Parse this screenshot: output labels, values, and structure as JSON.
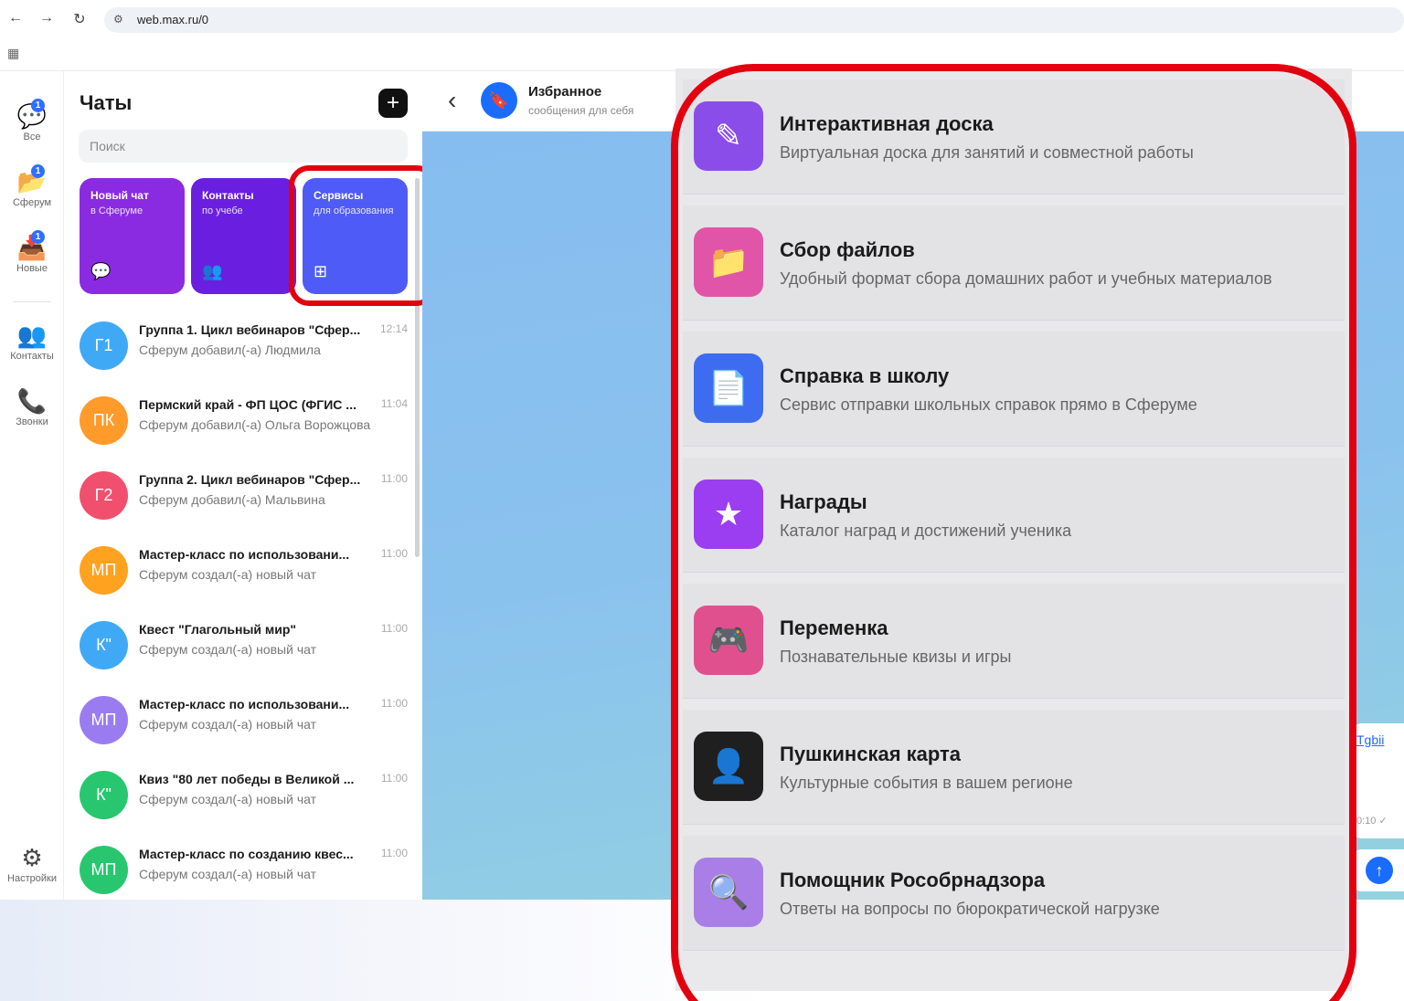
{
  "browser": {
    "url": "web.max.ru/0"
  },
  "rail": {
    "items": [
      {
        "label": "Все",
        "badge": "1"
      },
      {
        "label": "Сферум",
        "badge": "1"
      },
      {
        "label": "Новые",
        "badge": "1"
      },
      {
        "label": "Контакты"
      },
      {
        "label": "Звонки"
      }
    ],
    "settings_label": "Настройки"
  },
  "sidebar": {
    "title": "Чаты",
    "search_placeholder": "Поиск",
    "cards": [
      {
        "title": "Новый чат",
        "subtitle": "в Сферуме",
        "color": "#8a2be2"
      },
      {
        "title": "Контакты",
        "subtitle": "по учебе",
        "color": "#6a1fe0"
      },
      {
        "title": "Сервисы",
        "subtitle": "для образования",
        "color": "#4f5bf7"
      }
    ],
    "chats": [
      {
        "initials": "Г1",
        "title": "Группа 1. Цикл вебинаров \"Сфер...",
        "subtitle": "Сферум добавил(-а) Людмила",
        "time": "12:14",
        "color": "#3fa9f5"
      },
      {
        "initials": "ПК",
        "title": "Пермский край - ФП ЦОС (ФГИС ...",
        "subtitle": "Сферум добавил(-а) Ольга Ворожцова",
        "time": "11:04",
        "color": "#ff9a2b"
      },
      {
        "initials": "Г2",
        "title": "Группа 2. Цикл вебинаров \"Сфер...",
        "subtitle": "Сферум добавил(-а) Мальвина",
        "time": "11:00",
        "color": "#f0506e"
      },
      {
        "initials": "МП",
        "title": "Мастер-класс по использовани...",
        "subtitle": "Сферум создал(-а) новый чат",
        "time": "11:00",
        "color": "#ffa21f"
      },
      {
        "initials": "К\"",
        "title": "Квест \"Глагольный мир\"",
        "subtitle": "Сферум создал(-а) новый чат",
        "time": "11:00",
        "color": "#3fa9f5"
      },
      {
        "initials": "МП",
        "title": "Мастер-класс по использовани...",
        "subtitle": "Сферум создал(-а) новый чат",
        "time": "11:00",
        "color": "#9b7cf0"
      },
      {
        "initials": "К\"",
        "title": "Квиз \"80 лет победы в Великой ...",
        "subtitle": "Сферум создал(-а) новый чат",
        "time": "11:00",
        "color": "#28c76f"
      },
      {
        "initials": "МП",
        "title": "Мастер-класс по созданию квес...",
        "subtitle": "Сферум создал(-а) новый чат",
        "time": "11:00",
        "color": "#28c76f"
      }
    ]
  },
  "chat": {
    "name": "Избранное",
    "status": "сообщения для себя",
    "message_fragment": "Tgbii",
    "message_time": "0:10 ✓"
  },
  "services": [
    {
      "title": "Интерактивная доска",
      "desc": "Виртуальная доска для занятий и совместной работы",
      "icon": "pencil-icon",
      "color": "#8a4dea"
    },
    {
      "title": "Сбор файлов",
      "desc": "Удобный формат сбора домашних работ и учебных материалов",
      "icon": "folder-icon",
      "color": "#e055a8"
    },
    {
      "title": "Справка в школу",
      "desc": "Сервис отправки школьных справок прямо в Сферуме",
      "icon": "document-icon",
      "color": "#3d6cf0"
    },
    {
      "title": "Награды",
      "desc": "Каталог наград и достижений ученика",
      "icon": "star-icon",
      "color": "#9b3df0"
    },
    {
      "title": "Переменка",
      "desc": "Познавательные квизы и игры",
      "icon": "gamepad-icon",
      "color": "#e0508f"
    },
    {
      "title": "Пушкинская карта",
      "desc": "Культурные события в вашем регионе",
      "icon": "portrait-icon",
      "color": "#1f1f1f"
    },
    {
      "title": "Помощник Рособрнадзора",
      "desc": "Ответы на вопросы по бюрократической нагрузке",
      "icon": "magnifier-icon",
      "color": "#a97ee6"
    }
  ]
}
